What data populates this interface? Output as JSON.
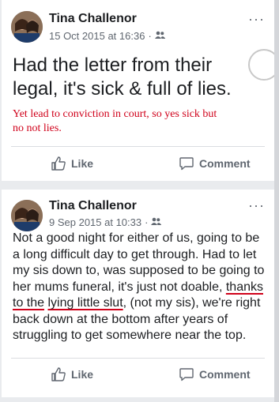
{
  "posts": [
    {
      "author": "Tina Challenor",
      "timestamp": "15 Oct 2015 at 16:36",
      "audience_icon": "friends-icon",
      "text": "Had the letter from their legal, it's  sick & full of lies.",
      "annotation": "Yet lead to conviction in court, so yes sick but no not lies.",
      "like_label": "Like",
      "comment_label": "Comment"
    },
    {
      "author": "Tina Challenor",
      "timestamp": "9 Sep 2015 at 10:33",
      "audience_icon": "friends-icon",
      "text_part1": "Not a good night for either of us, going to be a long difficult day to get through. Had to let my sis down to, was supposed to be going to her mums funeral, it's just not doable, ",
      "text_underlined_a": "thanks to the",
      "text_underlined_b": "lying little slut",
      "text_part2": ", (not my sis), we're right back down at the bottom after years of struggling to get somewhere near the top.",
      "like_label": "Like",
      "comment_label": "Comment"
    }
  ],
  "more_glyph": "···",
  "separator": "·",
  "colors": {
    "annotation": "#d0021b",
    "underline": "#d0021b",
    "text": "#1c1e21",
    "meta": "#606770"
  }
}
